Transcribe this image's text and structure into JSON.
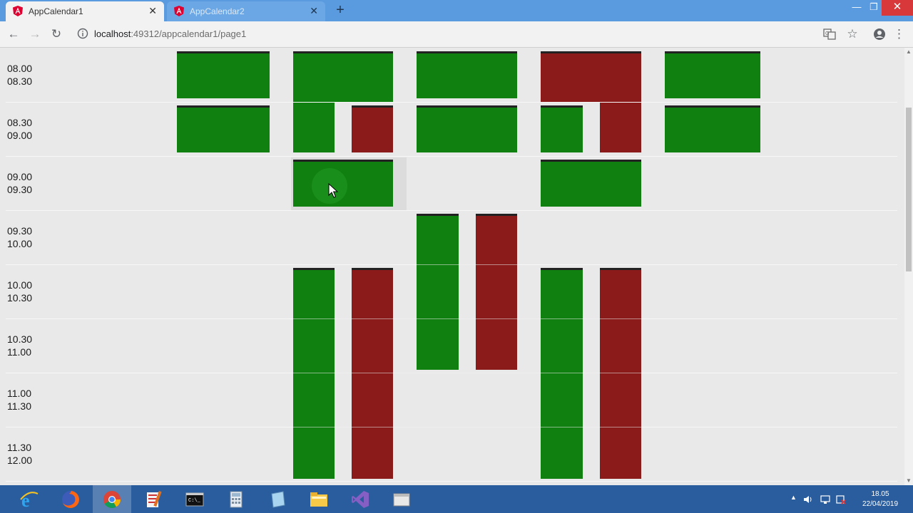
{
  "browser": {
    "tabs": [
      {
        "title": "AppCalendar1",
        "active": true
      },
      {
        "title": "AppCalendar2",
        "active": false
      }
    ],
    "new_tab": "+",
    "window_controls": {
      "minimize": "—",
      "restore": "❐",
      "close": "✕"
    },
    "address": {
      "host": "localhost",
      "rest": ":49312/appcalendar1/page1"
    },
    "icons": [
      "back-icon",
      "forward-icon",
      "reload-icon",
      "info-icon",
      "translate-icon",
      "star-icon",
      "account-icon",
      "menu-icon"
    ]
  },
  "calendar": {
    "time_slots": [
      {
        "start": "08.00",
        "end": "08.30"
      },
      {
        "start": "08.30",
        "end": "09.00"
      },
      {
        "start": "09.00",
        "end": "09.30"
      },
      {
        "start": "09.30",
        "end": "10.00"
      },
      {
        "start": "10.00",
        "end": "10.30"
      },
      {
        "start": "10.30",
        "end": "11.00"
      },
      {
        "start": "11.00",
        "end": "11.30"
      },
      {
        "start": "11.30",
        "end": "12.00"
      }
    ],
    "colors": {
      "free": "#108010",
      "busy": "#8b1a1a",
      "background": "#e9e9e9"
    }
  },
  "taskbar": {
    "apps": [
      "internet-explorer-icon",
      "firefox-icon",
      "chrome-icon",
      "notes-icon",
      "terminal-icon",
      "calculator-icon",
      "notepad-icon",
      "file-explorer-icon",
      "visual-studio-icon",
      "window-icon"
    ],
    "active_app": "chrome-icon",
    "clock": {
      "time": "18.05",
      "date": "22/04/2019"
    }
  }
}
